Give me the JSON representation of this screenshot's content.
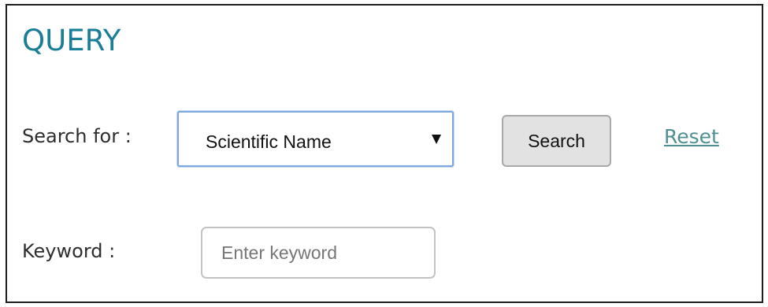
{
  "query": {
    "title": "QUERY",
    "search_for_label": "Search for :",
    "search_for_select": {
      "selected": "Scientific Name"
    },
    "search_button_label": "Search",
    "reset_link_label": "Reset",
    "keyword_label": "Keyword :",
    "keyword_input": {
      "value": "",
      "placeholder": "Enter keyword"
    }
  },
  "colors": {
    "title": "#1a7e96",
    "link": "#4f8f92",
    "button_bg": "#e2e2e2",
    "select_focus_border": "#7ea6e0"
  },
  "icons": {
    "select_arrow": "caret-down-icon"
  }
}
